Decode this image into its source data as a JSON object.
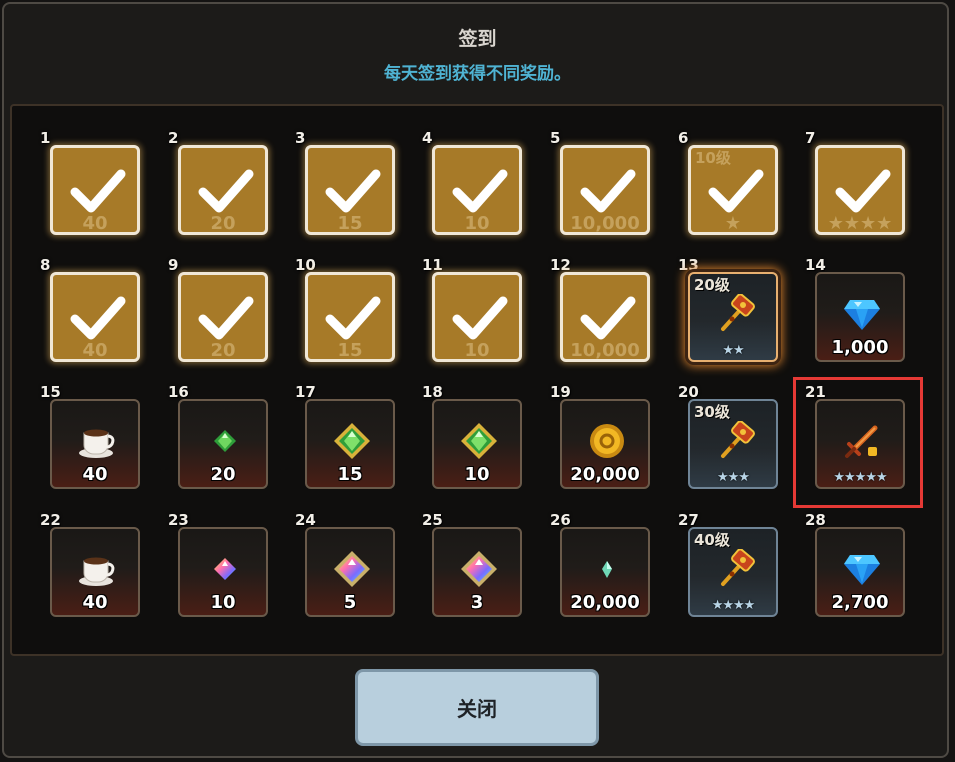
{
  "header": {
    "title": "签到",
    "subtitle": "每天签到获得不同奖励。"
  },
  "close_label": "关闭",
  "days": [
    {
      "day": "1",
      "reward": "coffee-icon",
      "amount": "40",
      "claimed": true
    },
    {
      "day": "2",
      "reward": "green-gem-icon",
      "amount": "20",
      "claimed": true
    },
    {
      "day": "3",
      "reward": "green-gem-icon",
      "amount": "15",
      "claimed": true
    },
    {
      "day": "4",
      "reward": "green-gem-icon",
      "amount": "10",
      "claimed": true
    },
    {
      "day": "5",
      "reward": "gold-coin-icon",
      "amount": "10,000",
      "claimed": true
    },
    {
      "day": "6",
      "reward": "hammer-icon",
      "level": "10级",
      "stars": "★",
      "claimed": true
    },
    {
      "day": "7",
      "reward": "sword-icon",
      "stars": "★★★★",
      "claimed": true
    },
    {
      "day": "8",
      "reward": "coffee-icon",
      "amount": "40",
      "claimed": true
    },
    {
      "day": "9",
      "reward": "green-gem-icon",
      "amount": "20",
      "claimed": true
    },
    {
      "day": "10",
      "reward": "green-gem-icon",
      "amount": "15",
      "claimed": true
    },
    {
      "day": "11",
      "reward": "green-gem-icon",
      "amount": "10",
      "claimed": true
    },
    {
      "day": "12",
      "reward": "gold-coin-icon",
      "amount": "10,000",
      "claimed": true
    },
    {
      "day": "13",
      "reward": "hammer-icon",
      "level": "20级",
      "stars": "★★",
      "claimed": false,
      "current": true
    },
    {
      "day": "14",
      "reward": "blue-diamond-icon",
      "amount": "1,000",
      "claimed": false
    },
    {
      "day": "15",
      "reward": "coffee-icon",
      "amount": "40",
      "claimed": false
    },
    {
      "day": "16",
      "reward": "small-green-gem-icon",
      "amount": "20",
      "claimed": false
    },
    {
      "day": "17",
      "reward": "green-gem-icon",
      "amount": "15",
      "claimed": false
    },
    {
      "day": "18",
      "reward": "green-gem-icon",
      "amount": "10",
      "claimed": false
    },
    {
      "day": "19",
      "reward": "gold-coin-icon",
      "amount": "20,000",
      "claimed": false
    },
    {
      "day": "20",
      "reward": "hammer-icon",
      "level": "30级",
      "stars": "★★★",
      "claimed": false
    },
    {
      "day": "21",
      "reward": "sword-icon",
      "stars": "★★★★★",
      "claimed": false,
      "highlighted": true
    },
    {
      "day": "22",
      "reward": "coffee-icon",
      "amount": "40",
      "claimed": false
    },
    {
      "day": "23",
      "reward": "small-rainbow-gem-icon",
      "amount": "10",
      "claimed": false
    },
    {
      "day": "24",
      "reward": "rainbow-gem-icon",
      "amount": "5",
      "claimed": false
    },
    {
      "day": "25",
      "reward": "rainbow-gem-icon",
      "amount": "3",
      "claimed": false
    },
    {
      "day": "26",
      "reward": "crystal-shard-icon",
      "amount": "20,000",
      "claimed": false
    },
    {
      "day": "27",
      "reward": "hammer-icon",
      "level": "40级",
      "stars": "★★★★",
      "claimed": false
    },
    {
      "day": "28",
      "reward": "blue-diamond-icon",
      "amount": "2,700",
      "claimed": false
    }
  ],
  "colors": {
    "claimed": "#a77a28",
    "subtitle": "#4fb3d3",
    "highlight": "#e53935",
    "button": "#b8cfdd"
  }
}
